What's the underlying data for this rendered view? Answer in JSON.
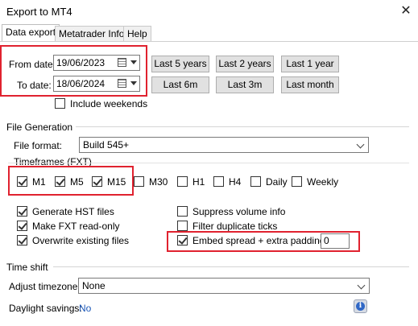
{
  "window": {
    "title": "Export to MT4",
    "close_glyph": "✕"
  },
  "tabs": [
    {
      "label": "Data export",
      "active": true
    },
    {
      "label": "Metatrader Info",
      "active": false
    },
    {
      "label": "Help",
      "active": false
    }
  ],
  "dates": {
    "from_label": "From date:",
    "from_value": "19/06/2023",
    "to_label": "To date:",
    "to_value": "18/06/2024"
  },
  "quick_buttons": [
    "Last 5 years",
    "Last 2 years",
    "Last 1 year",
    "Last 6m",
    "Last 3m",
    "Last month"
  ],
  "include_weekends": {
    "label": "Include weekends",
    "checked": false
  },
  "file_generation": {
    "group_title": "File Generation",
    "file_format_label": "File format:",
    "file_format_value": "Build 545+",
    "timeframes_label": "Timeframes (FXT)",
    "timeframes": [
      {
        "label": "M1",
        "checked": true
      },
      {
        "label": "M5",
        "checked": true
      },
      {
        "label": "M15",
        "checked": true
      },
      {
        "label": "M30",
        "checked": false
      },
      {
        "label": "H1",
        "checked": false
      },
      {
        "label": "H4",
        "checked": false
      },
      {
        "label": "Daily",
        "checked": false
      },
      {
        "label": "Weekly",
        "checked": false
      }
    ],
    "options_left": [
      {
        "label": "Generate HST files",
        "checked": true
      },
      {
        "label": "Make FXT read-only",
        "checked": true
      },
      {
        "label": "Overwrite existing files",
        "checked": true
      }
    ],
    "options_right": [
      {
        "label": "Suppress volume info",
        "checked": false
      },
      {
        "label": "Filter duplicate ticks",
        "checked": false
      },
      {
        "label": "Embed spread + extra padding of",
        "checked": true
      }
    ],
    "padding_value": "0"
  },
  "time_shift": {
    "group_title": "Time shift",
    "adjust_tz_label": "Adjust timezone:",
    "adjust_tz_value": "None",
    "dst_label": "Daylight savings:",
    "dst_value": "No",
    "info_glyph": "i"
  },
  "colors": {
    "highlight": "#e0222f",
    "link": "#1a57b8"
  }
}
